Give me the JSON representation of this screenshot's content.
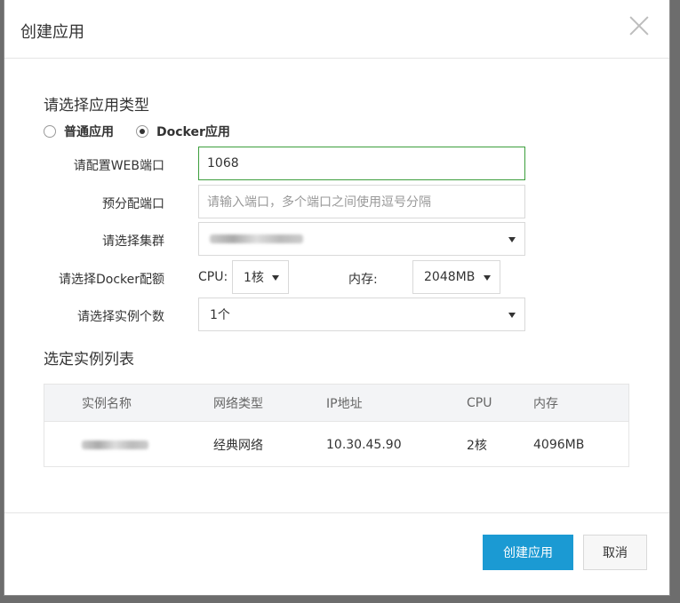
{
  "dialog": {
    "title": "创建应用",
    "close_icon": "close-icon"
  },
  "app_type": {
    "heading": "请选择应用类型",
    "options": [
      {
        "label": "普通应用",
        "checked": false
      },
      {
        "label": "Docker应用",
        "checked": true
      }
    ]
  },
  "form": {
    "web_port": {
      "label": "请配置WEB端口",
      "value": "1068"
    },
    "pre_port": {
      "label": "预分配端口",
      "placeholder": "请输入端口，多个端口之间使用逗号分隔"
    },
    "cluster": {
      "label": "请选择集群"
    },
    "docker_config": {
      "label": "请选择Docker配额",
      "cpu_label": "CPU:",
      "cpu_value": "1核",
      "mem_label": "内存:",
      "mem_value": "2048MB"
    },
    "instance_count": {
      "label": "请选择实例个数",
      "value": "1个"
    }
  },
  "instances": {
    "heading": "选定实例列表",
    "columns": [
      "实例名称",
      "网络类型",
      "IP地址",
      "CPU",
      "内存"
    ],
    "rows": [
      {
        "network": "经典网络",
        "ip": "10.30.45.90",
        "cpu": "2核",
        "memory": "4096MB"
      }
    ]
  },
  "footer": {
    "create_label": "创建应用",
    "cancel_label": "取消"
  },
  "colors": {
    "primary": "#1b9ad3",
    "active_border": "#3c9e3c"
  }
}
